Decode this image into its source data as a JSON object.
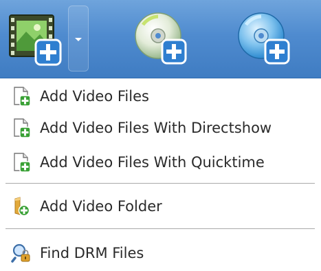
{
  "toolbar": {
    "buttons": [
      {
        "icon": "add-video-icon"
      },
      {
        "icon": "add-dvd-icon"
      },
      {
        "icon": "add-bluray-icon"
      }
    ],
    "dropdown_icon": "chevron-down-icon"
  },
  "menu": {
    "items": [
      {
        "label": "Add Video Files",
        "icon": "add-file-icon"
      },
      {
        "label": "Add Video Files With Directshow",
        "icon": "add-file-icon"
      },
      {
        "label": "Add Video Files With Quicktime",
        "icon": "add-file-icon"
      },
      {
        "label": "Add Video Folder",
        "icon": "add-folder-icon"
      },
      {
        "label": "Find DRM Files",
        "icon": "find-drm-icon"
      }
    ]
  },
  "colors": {
    "toolbar_top": "#6fa4dc",
    "toolbar_bottom": "#3f7cc2",
    "plus_blue": "#2f7fd0",
    "plus_green": "#3aa136"
  }
}
